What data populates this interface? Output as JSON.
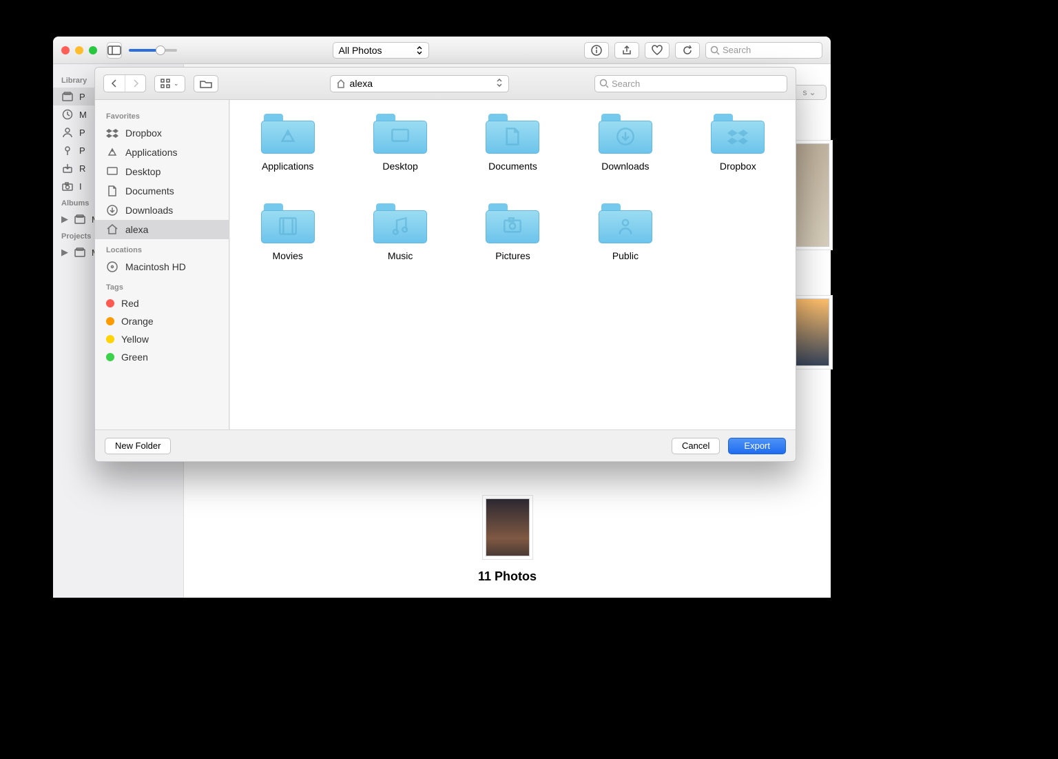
{
  "photos": {
    "view_dropdown": "All Photos",
    "search_placeholder": "Search",
    "sidebar": {
      "library_heading": "Library",
      "library_items": [
        "P",
        "M",
        "P",
        "P",
        "R",
        "I"
      ],
      "albums_heading": "Albums",
      "albums_items": [
        "M"
      ],
      "projects_heading": "Projects",
      "projects_items": [
        "M"
      ]
    },
    "count_label": "11 Photos",
    "grid_popup": "s"
  },
  "sheet": {
    "location_selected": "alexa",
    "search_placeholder": "Search",
    "favorites_heading": "Favorites",
    "favorites": [
      {
        "label": "Dropbox",
        "icon": "dropbox"
      },
      {
        "label": "Applications",
        "icon": "apps"
      },
      {
        "label": "Desktop",
        "icon": "desktop"
      },
      {
        "label": "Documents",
        "icon": "documents"
      },
      {
        "label": "Downloads",
        "icon": "downloads"
      },
      {
        "label": "alexa",
        "icon": "home",
        "selected": true
      }
    ],
    "locations_heading": "Locations",
    "locations": [
      {
        "label": "Macintosh HD",
        "icon": "disk"
      }
    ],
    "tags_heading": "Tags",
    "tags": [
      {
        "label": "Red",
        "color": "#ff5a52"
      },
      {
        "label": "Orange",
        "color": "#ff9a00"
      },
      {
        "label": "Yellow",
        "color": "#ffd400"
      },
      {
        "label": "Green",
        "color": "#3bd14b"
      }
    ],
    "folders": [
      {
        "label": "Applications",
        "icon": "apps"
      },
      {
        "label": "Desktop",
        "icon": "desktop"
      },
      {
        "label": "Documents",
        "icon": "documents"
      },
      {
        "label": "Downloads",
        "icon": "downloads"
      },
      {
        "label": "Dropbox",
        "icon": "dropbox"
      },
      {
        "label": "Movies",
        "icon": "movies"
      },
      {
        "label": "Music",
        "icon": "music"
      },
      {
        "label": "Pictures",
        "icon": "pictures"
      },
      {
        "label": "Public",
        "icon": "public"
      }
    ],
    "buttons": {
      "new_folder": "New Folder",
      "cancel": "Cancel",
      "export": "Export"
    }
  }
}
